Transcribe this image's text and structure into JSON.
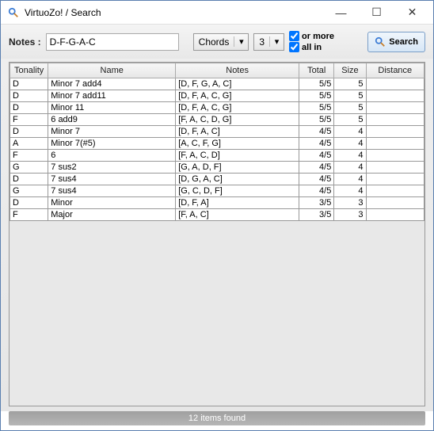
{
  "window": {
    "title": "VirtuoZo! / Search"
  },
  "toolbar": {
    "notes_label": "Notes :",
    "notes_value": "D-F-G-A-C",
    "mode_value": "Chords",
    "count_value": "3",
    "or_more_label": "or more",
    "all_in_label": "all in",
    "or_more_checked": true,
    "all_in_checked": true,
    "search_label": "Search"
  },
  "grid": {
    "headers": {
      "tonality": "Tonality",
      "name": "Name",
      "notes": "Notes",
      "total": "Total",
      "size": "Size",
      "distance": "Distance"
    },
    "rows": [
      {
        "tonality": "D",
        "name": "Minor 7 add4",
        "notes": "[D, F, G, A, C]",
        "total": "5/5",
        "size": "5",
        "distance": ""
      },
      {
        "tonality": "D",
        "name": "Minor 7 add11",
        "notes": "[D, F, A, C, G]",
        "total": "5/5",
        "size": "5",
        "distance": ""
      },
      {
        "tonality": "D",
        "name": "Minor 11",
        "notes": "[D, F, A, C, G]",
        "total": "5/5",
        "size": "5",
        "distance": ""
      },
      {
        "tonality": "F",
        "name": "6 add9",
        "notes": "[F, A, C, D, G]",
        "total": "5/5",
        "size": "5",
        "distance": ""
      },
      {
        "tonality": "D",
        "name": "Minor 7",
        "notes": "[D, F, A, C]",
        "total": "4/5",
        "size": "4",
        "distance": ""
      },
      {
        "tonality": "A",
        "name": "Minor 7(#5)",
        "notes": "[A, C, F, G]",
        "total": "4/5",
        "size": "4",
        "distance": ""
      },
      {
        "tonality": "F",
        "name": "6",
        "notes": "[F, A, C, D]",
        "total": "4/5",
        "size": "4",
        "distance": ""
      },
      {
        "tonality": "G",
        "name": "7 sus2",
        "notes": "[G, A, D, F]",
        "total": "4/5",
        "size": "4",
        "distance": ""
      },
      {
        "tonality": "D",
        "name": "7 sus4",
        "notes": "[D, G, A, C]",
        "total": "4/5",
        "size": "4",
        "distance": ""
      },
      {
        "tonality": "G",
        "name": "7 sus4",
        "notes": "[G, C, D, F]",
        "total": "4/5",
        "size": "4",
        "distance": ""
      },
      {
        "tonality": "D",
        "name": "Minor",
        "notes": "[D, F, A]",
        "total": "3/5",
        "size": "3",
        "distance": ""
      },
      {
        "tonality": "F",
        "name": "Major",
        "notes": "[F, A, C]",
        "total": "3/5",
        "size": "3",
        "distance": ""
      }
    ]
  },
  "status": {
    "text": "12 items found"
  }
}
